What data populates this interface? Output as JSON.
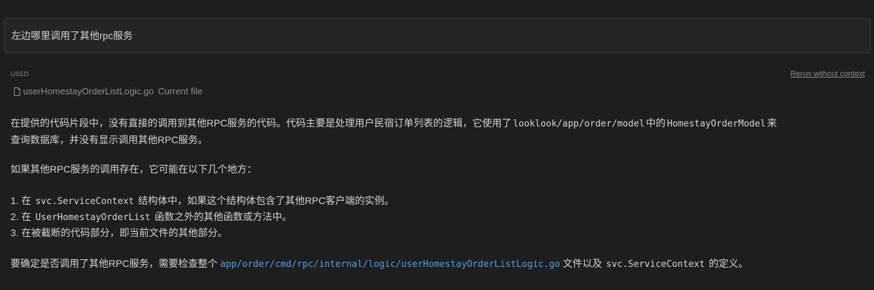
{
  "query": "左边哪里调用了其他rpc服务",
  "context": {
    "used_label": "USED",
    "rerun_label": "Rerun without context",
    "file_name": "userHomestayOrderListLogic.go",
    "file_tag": "Current file",
    "file_icon": "document-icon"
  },
  "answer": {
    "p1": {
      "t1": "在提供的代码片段中，没有直接的调用到其他RPC服务的代码。代码主要是处理用户民宿订单列表的逻辑，它使用了",
      "c1": "looklook/app/order/model",
      "t2": "中的",
      "c2": "HomestayOrderModel",
      "t3": "来",
      "t4": "查询数据库，并没有显示调用其他RPC服务。"
    },
    "p2": "如果其他RPC服务的调用存在，它可能在以下几个地方：",
    "list": [
      {
        "prefix": "1. 在",
        "code": "svc.ServiceContext",
        "suffix": "结构体中，如果这个结构体包含了其他RPC客户端的实例。"
      },
      {
        "prefix": "2. 在",
        "code": "UserHomestayOrderList",
        "suffix": "函数之外的其他函数或方法中。"
      },
      {
        "prefix": "3. 在被截断的代码部分，即当前文件的其他部分。",
        "code": "",
        "suffix": ""
      }
    ],
    "p3": {
      "t1": "要确定是否调用了其他RPC服务，需要检查整个",
      "link": "app/order/cmd/rpc/internal/logic/userHomestayOrderListLogic.go",
      "t2": "文件以及",
      "c1": "svc.ServiceContext",
      "t3": "的定义。"
    }
  },
  "colors": {
    "background": "#1e1e1e",
    "link": "#4f9fe6"
  }
}
